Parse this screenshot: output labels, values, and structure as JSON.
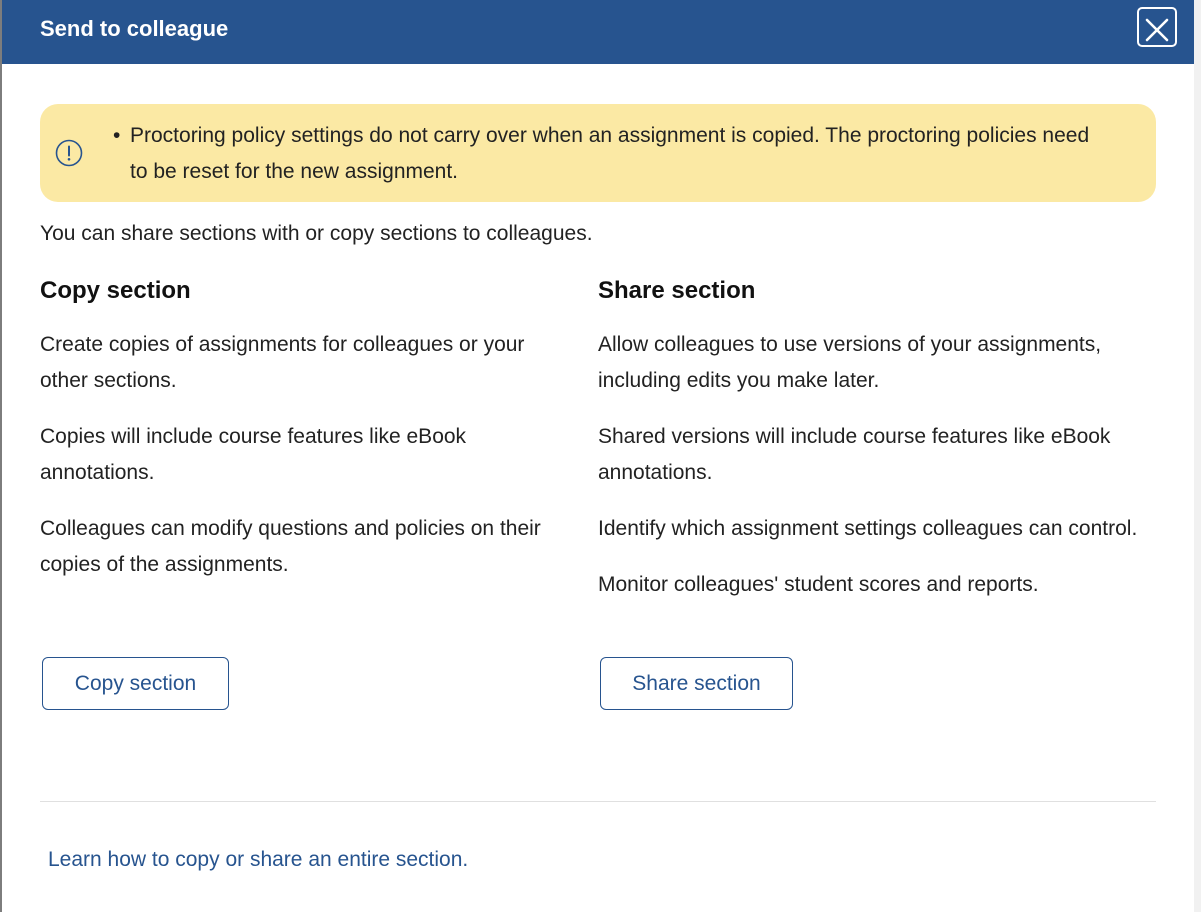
{
  "modal": {
    "title": "Send to colleague",
    "close_icon": "close-icon"
  },
  "alert": {
    "icon": "exclamation-circle-icon",
    "items": [
      "Proctoring policy settings do not carry over when an assignment is copied. The proctoring policies need to be reset for the new assignment."
    ]
  },
  "intro": "You can share sections with or copy sections to colleagues.",
  "copy_section": {
    "heading": "Copy section",
    "paragraphs": [
      "Create copies of assignments for colleagues or your other sections.",
      "Copies will include course features like eBook annotations.",
      "Colleagues can modify questions and policies on their copies of the assignments."
    ],
    "button_label": "Copy section"
  },
  "share_section": {
    "heading": "Share section",
    "paragraphs": [
      "Allow colleagues to use versions of your assignments, including edits you make later.",
      "Shared versions will include course features like eBook annotations.",
      "Identify which assignment settings colleagues can control.",
      "Monitor colleagues' student scores and reports."
    ],
    "button_label": "Share section"
  },
  "footer": {
    "link_text": "Learn how to copy or share an entire section."
  },
  "colors": {
    "header_bg": "#27548f",
    "alert_bg": "#fbe9a4",
    "link": "#27548f"
  }
}
